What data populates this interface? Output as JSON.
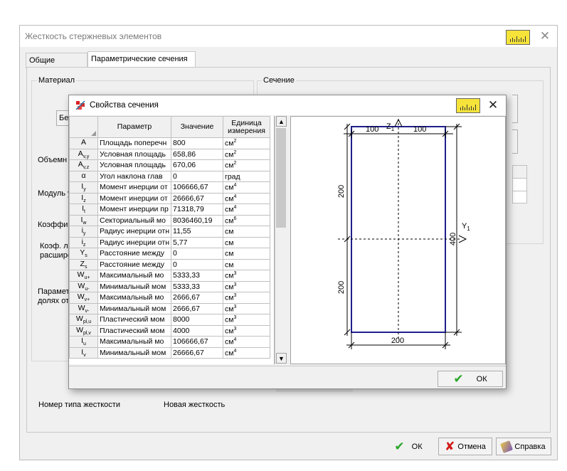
{
  "main_window": {
    "title": "Жесткость стержневых элементов",
    "close_glyph": "✕"
  },
  "tabs": [
    {
      "label": "Общие данные"
    },
    {
      "label": "Параметрические сечения"
    }
  ],
  "left_panel": {
    "group_title": "Материал",
    "material_button": "Бет",
    "labels": [
      "Объемн",
      "Модуль у",
      "Коэффи",
      "Коэф. л",
      "расшире",
      "Парамет",
      "долях от"
    ]
  },
  "right_panel": {
    "group_title": "Сечение"
  },
  "footer": {
    "stiffness_label": "Номер типа жесткости",
    "stiffness_value": "Новая жесткость"
  },
  "main_buttons": {
    "ok": "ОК",
    "cancel": "Отмена",
    "help": "Справка"
  },
  "dialog": {
    "title": "Свойства сечения",
    "close_glyph": "✕",
    "ok": "ОК"
  },
  "grid": {
    "headers": {
      "param": "Параметр",
      "value": "Значение",
      "unit": "Единица измерения"
    },
    "rows": [
      {
        "sym": "A",
        "sub": "",
        "name": "Площадь поперечн",
        "value": "800",
        "unit": "см",
        "exp": "2"
      },
      {
        "sym": "A",
        "sub": "v,y",
        "name": "Условная площадь",
        "value": "658,86",
        "unit": "см",
        "exp": "2"
      },
      {
        "sym": "A",
        "sub": "v,z",
        "name": "Условная площадь",
        "value": "670,06",
        "unit": "см",
        "exp": "2"
      },
      {
        "sym": "α",
        "sub": "",
        "name": "Угол наклона глав",
        "value": "0",
        "unit": "град",
        "exp": ""
      },
      {
        "sym": "I",
        "sub": "y",
        "name": "Момент инерции от",
        "value": "106666,67",
        "unit": "см",
        "exp": "4"
      },
      {
        "sym": "I",
        "sub": "z",
        "name": "Момент инерции от",
        "value": "26666,67",
        "unit": "см",
        "exp": "4"
      },
      {
        "sym": "I",
        "sub": "t",
        "name": "Момент инерции пр",
        "value": "71318,79",
        "unit": "см",
        "exp": "4"
      },
      {
        "sym": "I",
        "sub": "w",
        "name": "Секториальный мо",
        "value": "8036460,19",
        "unit": "см",
        "exp": "6"
      },
      {
        "sym": "i",
        "sub": "y",
        "name": "Радиус инерции отн",
        "value": "11,55",
        "unit": "см",
        "exp": ""
      },
      {
        "sym": "i",
        "sub": "z",
        "name": "Радиус инерции отн",
        "value": "5,77",
        "unit": "см",
        "exp": ""
      },
      {
        "sym": "Y",
        "sub": "s",
        "name": "Расстояние между",
        "value": "0",
        "unit": "см",
        "exp": ""
      },
      {
        "sym": "Z",
        "sub": "s",
        "name": "Расстояние между",
        "value": "0",
        "unit": "см",
        "exp": ""
      },
      {
        "sym": "W",
        "sub": "u+",
        "name": "Максимальный мо",
        "value": "5333,33",
        "unit": "см",
        "exp": "3"
      },
      {
        "sym": "W",
        "sub": "u-",
        "name": "Минимальный мом",
        "value": "5333,33",
        "unit": "см",
        "exp": "3"
      },
      {
        "sym": "W",
        "sub": "v+",
        "name": "Максимальный мо",
        "value": "2666,67",
        "unit": "см",
        "exp": "3"
      },
      {
        "sym": "W",
        "sub": "v-",
        "name": "Минимальный мом",
        "value": "2666,67",
        "unit": "см",
        "exp": "3"
      },
      {
        "sym": "W",
        "sub": "pl,u",
        "name": "Пластический мом",
        "value": "8000",
        "unit": "см",
        "exp": "3"
      },
      {
        "sym": "W",
        "sub": "pl,v",
        "name": "Пластический мом",
        "value": "4000",
        "unit": "см",
        "exp": "3"
      },
      {
        "sym": "I",
        "sub": "u",
        "name": "Максимальный мо",
        "value": "106666,67",
        "unit": "см",
        "exp": "4"
      },
      {
        "sym": "I",
        "sub": "v",
        "name": "Минимальный мом",
        "value": "26666,67",
        "unit": "см",
        "exp": "4"
      }
    ]
  },
  "drawing": {
    "dim_top_left": "100",
    "dim_top_right": "100",
    "dim_left_upper": "200",
    "dim_left_lower": "200",
    "dim_right": "400",
    "dim_bottom": "200",
    "axis_z": "Z",
    "axis_z_sub": "1",
    "axis_y": "Y",
    "axis_y_sub": "1"
  },
  "colors": {
    "section_outline": "#1f1f8c",
    "ok_check": "#2aa52a",
    "cancel_x": "#d11a1a"
  }
}
